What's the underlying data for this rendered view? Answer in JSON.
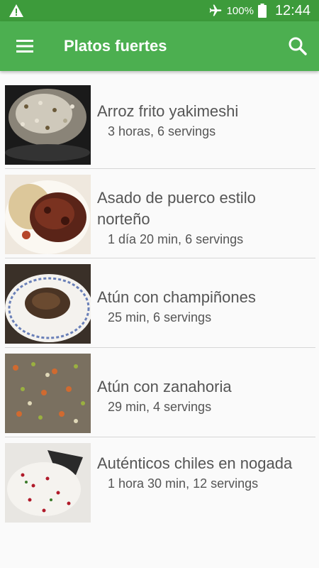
{
  "status_bar": {
    "battery_percent": "100%",
    "time": "12:44",
    "icons": [
      "warning-icon",
      "airplane-mode-icon",
      "battery-icon"
    ]
  },
  "app_bar": {
    "title": "Platos fuertes",
    "icons": [
      "menu-icon",
      "search-icon"
    ],
    "color": "#4caf50"
  },
  "recipes": [
    {
      "name": "Arroz frito yakimeshi",
      "meta": "3 horas, 6 servings"
    },
    {
      "name": "Asado de puerco estilo norteño",
      "meta": "1 día 20 min, 6 servings"
    },
    {
      "name": "Atún con champiñones",
      "meta": "25 min, 6 servings"
    },
    {
      "name": "Atún con zanahoria",
      "meta": "29 min, 4 servings"
    },
    {
      "name": "Auténticos chiles en nogada",
      "meta": "1 hora 30 min, 12 servings"
    }
  ]
}
